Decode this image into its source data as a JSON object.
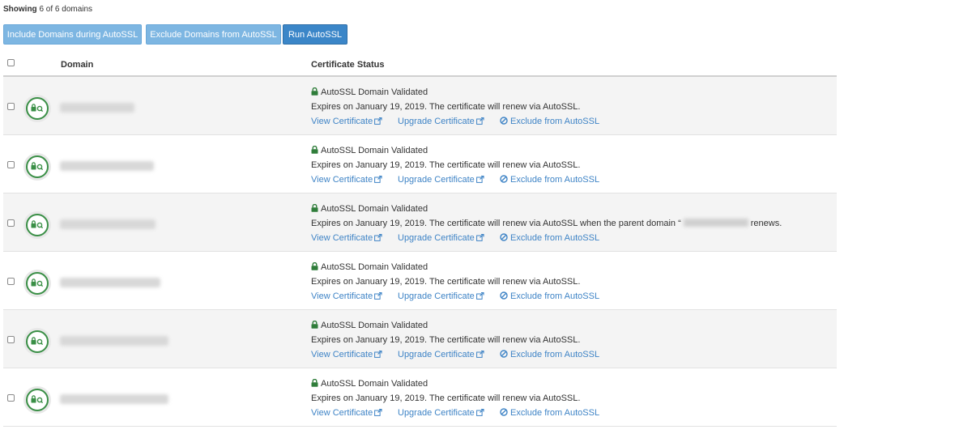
{
  "header": {
    "showing_label": "Showing",
    "showing_count": "6 of 6 domains"
  },
  "toolbar": {
    "include_label": "Include Domains during AutoSSL",
    "exclude_label": "Exclude Domains from AutoSSL",
    "run_label": "Run AutoSSL"
  },
  "table": {
    "col_domain": "Domain",
    "col_status": "Certificate Status"
  },
  "rows": [
    {
      "status": "AutoSSL Domain Validated",
      "expires": "Expires on January 19, 2019. The certificate will renew via AutoSSL.",
      "expires_suffix": "",
      "view": "View Certificate",
      "upgrade": "Upgrade Certificate",
      "exclude": "Exclude from AutoSSL"
    },
    {
      "status": "AutoSSL Domain Validated",
      "expires": "Expires on January 19, 2019. The certificate will renew via AutoSSL.",
      "expires_suffix": "",
      "view": "View Certificate",
      "upgrade": "Upgrade Certificate",
      "exclude": "Exclude from AutoSSL"
    },
    {
      "status": "AutoSSL Domain Validated",
      "expires": "Expires on January 19, 2019. The certificate will renew via AutoSSL when the parent domain “",
      "expires_suffix": "renews.",
      "view": "View Certificate",
      "upgrade": "Upgrade Certificate",
      "exclude": "Exclude from AutoSSL"
    },
    {
      "status": "AutoSSL Domain Validated",
      "expires": "Expires on January 19, 2019. The certificate will renew via AutoSSL.",
      "expires_suffix": "",
      "view": "View Certificate",
      "upgrade": "Upgrade Certificate",
      "exclude": "Exclude from AutoSSL"
    },
    {
      "status": "AutoSSL Domain Validated",
      "expires": "Expires on January 19, 2019. The certificate will renew via AutoSSL.",
      "expires_suffix": "",
      "view": "View Certificate",
      "upgrade": "Upgrade Certificate",
      "exclude": "Exclude from AutoSSL"
    },
    {
      "status": "AutoSSL Domain Validated",
      "expires": "Expires on January 19, 2019. The certificate will renew via AutoSSL.",
      "expires_suffix": "",
      "view": "View Certificate",
      "upgrade": "Upgrade Certificate",
      "exclude": "Exclude from AutoSSL"
    }
  ],
  "colors": {
    "accent": "#3f84c6",
    "button_light": "#7db6e2",
    "button_dark": "#3b86c8",
    "success": "#3a8f46"
  },
  "icons": {
    "status_lock": "lock-icon",
    "badge": "ssl-badge-icon",
    "external": "external-link-icon",
    "exclude": "ban-icon"
  }
}
